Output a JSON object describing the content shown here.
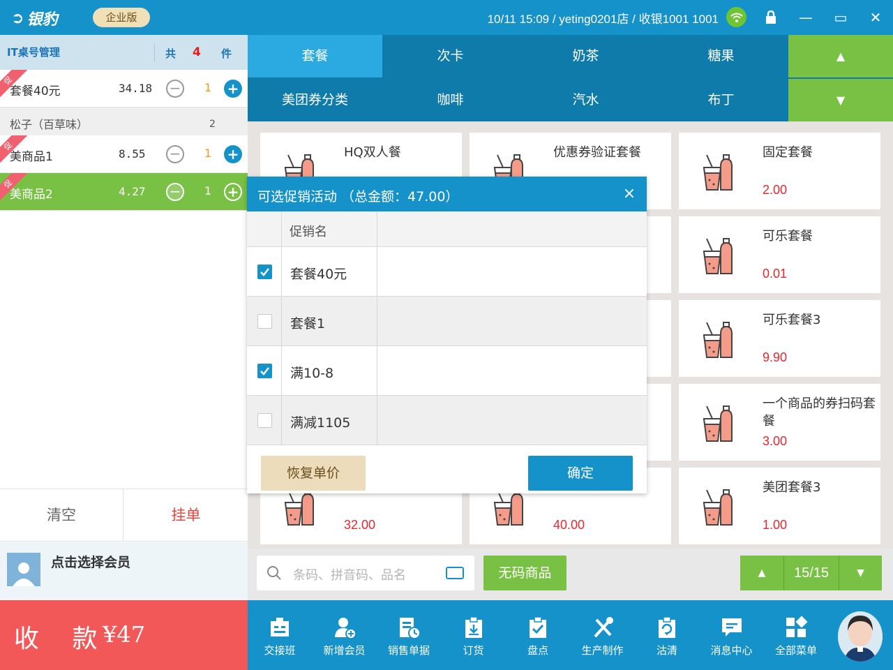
{
  "topbar": {
    "logo": "银豹",
    "edition": "企业版",
    "info": "10/11 15:09 / yeting0201店 / 收银1001 1001"
  },
  "cart": {
    "header_title": "IT桌号管理",
    "total_prefix": "共",
    "total_count": "4",
    "total_suffix": "件",
    "items": [
      {
        "name": "套餐40元",
        "price": "34.18",
        "qty": "1",
        "tag": "促"
      },
      {
        "name": "美商品1",
        "price": "8.55",
        "qty": "1",
        "tag": "促"
      },
      {
        "name": "美商品2",
        "price": "4.27",
        "qty": "1",
        "tag": "促"
      }
    ],
    "sub_item": {
      "name": "松子（百草味）",
      "qty": "2"
    },
    "clear_label": "清空",
    "hold_label": "挂单",
    "member_label": "点击选择会员",
    "pay_label": "收 款",
    "pay_amount": "¥47"
  },
  "categories": [
    {
      "label": "套餐",
      "active": true
    },
    {
      "label": "次卡"
    },
    {
      "label": "奶茶"
    },
    {
      "label": "糖果"
    },
    {
      "label": "美团券分类"
    },
    {
      "label": "咖啡"
    },
    {
      "label": "汽水"
    },
    {
      "label": "布丁"
    }
  ],
  "products": [
    {
      "name": "HQ双人餐",
      "price": ""
    },
    {
      "name": "优惠券验证套餐",
      "price": ""
    },
    {
      "name": "固定套餐",
      "price": "2.00"
    },
    {
      "name": "",
      "price": ""
    },
    {
      "name": "",
      "price": ""
    },
    {
      "name": "可乐套餐",
      "price": "0.01"
    },
    {
      "name": "",
      "price": ""
    },
    {
      "name": "",
      "price": ""
    },
    {
      "name": "可乐套餐3",
      "price": "9.90"
    },
    {
      "name": "",
      "price": ""
    },
    {
      "name": "",
      "price": ""
    },
    {
      "name": "一个商品的券扫码套餐",
      "price": "3.00"
    },
    {
      "name": "",
      "price": "32.00"
    },
    {
      "name": "",
      "price": "40.00"
    },
    {
      "name": "美团套餐3",
      "price": "1.00"
    }
  ],
  "search": {
    "placeholder": "条码、拼音码、品名"
  },
  "no_barcode_label": "无码商品",
  "pager": {
    "page": "15/15"
  },
  "toolbar": [
    {
      "label": "交接班",
      "icon": "handover-icon"
    },
    {
      "label": "新增会员",
      "icon": "add-member-icon"
    },
    {
      "label": "销售单据",
      "icon": "sales-doc-icon"
    },
    {
      "label": "订货",
      "icon": "order-icon"
    },
    {
      "label": "盘点",
      "icon": "inventory-icon"
    },
    {
      "label": "生产制作",
      "icon": "production-icon"
    },
    {
      "label": "沽清",
      "icon": "soldout-icon"
    },
    {
      "label": "消息中心",
      "icon": "message-icon"
    },
    {
      "label": "全部菜单",
      "icon": "all-menu-icon"
    }
  ],
  "dialog": {
    "title": "可选促销活动  （总金额：47.00）",
    "column_name": "促销名",
    "rows": [
      {
        "name": "套餐40元",
        "checked": true
      },
      {
        "name": "套餐1",
        "checked": false
      },
      {
        "name": "满10-8",
        "checked": true
      },
      {
        "name": "满减1105",
        "checked": false
      }
    ],
    "restore_label": "恢复单价",
    "confirm_label": "确定"
  },
  "colors": {
    "primary": "#1592c9",
    "green": "#78c144",
    "pay": "#f25857",
    "price_red": "#e8262d"
  }
}
